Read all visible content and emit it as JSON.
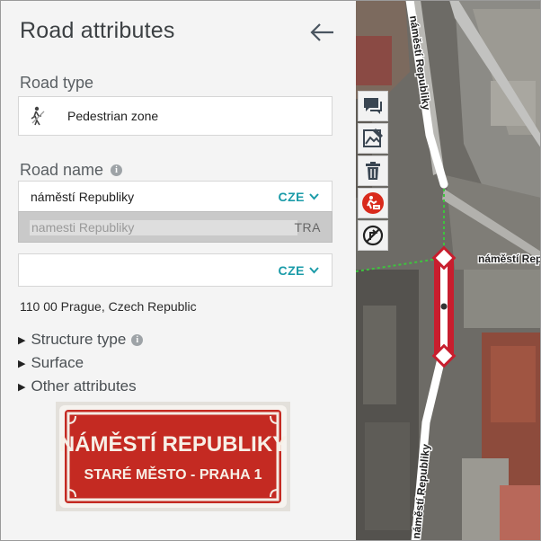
{
  "panel": {
    "title": "Road attributes",
    "road_type": {
      "label": "Road type",
      "value": "Pedestrian zone",
      "icon": "pedestrian-icon"
    },
    "road_name": {
      "label": "Road name",
      "value": "náměstí Republiky",
      "language": "CZE",
      "transliteration": "namesti Republiky",
      "transliteration_tag": "TRA",
      "second_value": "",
      "second_language": "CZE"
    },
    "address": "110 00 Prague, Czech Republic",
    "expanders": [
      "Structure type",
      "Surface",
      "Other attributes"
    ],
    "sign_photo": {
      "line1": "NÁMĚSTÍ REPUBLIKY",
      "line2": "STARÉ MĚSTO - PRAHA 1"
    }
  },
  "map": {
    "street_labels": [
      "náměstí Republiky",
      "náměstí Republiky",
      "náměstí Republiky"
    ],
    "tools": [
      "comment-icon",
      "edit-picture-icon",
      "delete-icon",
      "construction-icon",
      "restriction-icon"
    ],
    "colors": {
      "selected_road": "#c81e2e",
      "pedestrian_road": "#ffffff",
      "connector": "#3ec43e"
    }
  }
}
